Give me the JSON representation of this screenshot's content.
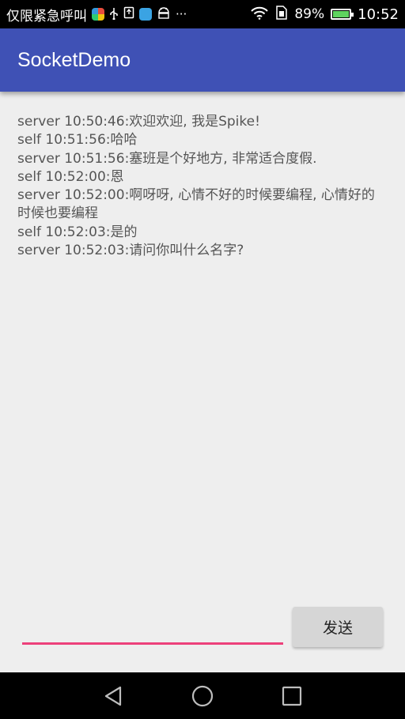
{
  "status_bar": {
    "carrier": "仅限紧急呼叫",
    "battery_percent": "89%",
    "battery_level": 0.89,
    "time": "10:52",
    "icons": [
      "app-icon",
      "usb-icon",
      "sim-icon",
      "app-icon",
      "android-debug-icon",
      "more-icon",
      "wifi-icon",
      "sim-card-icon",
      "battery-charging-icon"
    ]
  },
  "app_bar": {
    "title": "SocketDemo"
  },
  "messages": [
    "server 10:50:46:欢迎欢迎, 我是Spike!",
    "self 10:51:56:哈哈",
    "server 10:51:56:塞班是个好地方, 非常适合度假.",
    "self 10:52:00:恩",
    "server 10:52:00:啊呀呀, 心情不好的时候要编程, 心情好的时候也要编程",
    "self 10:52:03:是的",
    "server 10:52:03:请问你叫什么名字?"
  ],
  "composer": {
    "input_value": "",
    "input_placeholder": "",
    "send_label": "发送"
  },
  "colors": {
    "app_bar": "#3f51b5",
    "accent": "#ec407a",
    "background": "#eeeeee"
  },
  "nav_bar": {
    "icons": [
      "back-icon",
      "home-icon",
      "recents-icon"
    ]
  }
}
